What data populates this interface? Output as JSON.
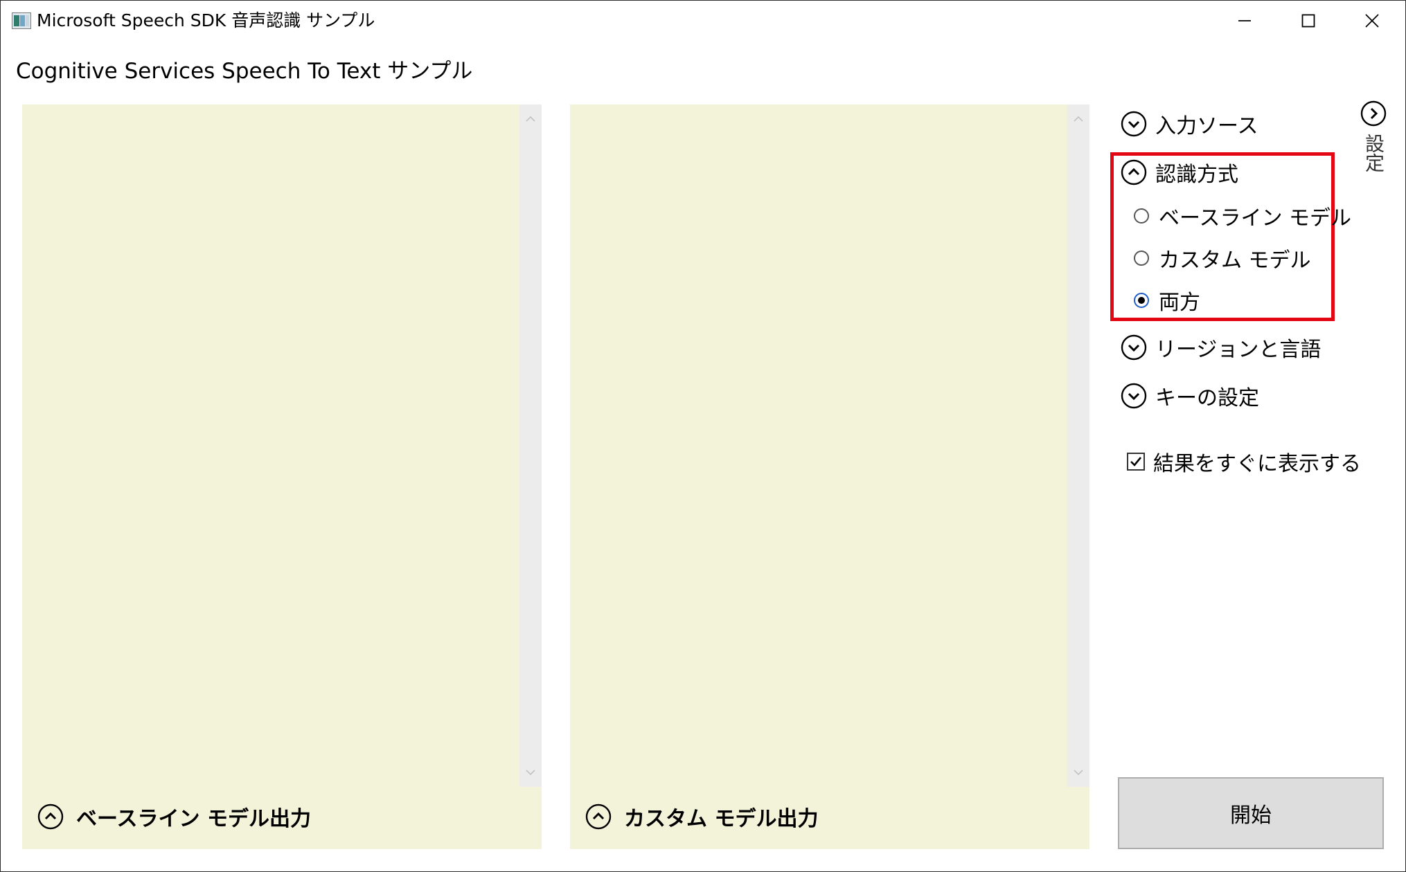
{
  "window": {
    "title": "Microsoft Speech SDK 音声認識 サンプル",
    "caption_buttons": [
      "minimize-icon",
      "maximize-icon",
      "close-icon"
    ]
  },
  "header": {
    "title": "Cognitive Services Speech To Text サンプル"
  },
  "panels": {
    "baseline": {
      "footer_label": "ベースライン モデル出力",
      "toggle_icon": "chevron-up-circle-icon"
    },
    "custom": {
      "footer_label": "カスタム モデル出力",
      "toggle_icon": "chevron-up-circle-icon"
    }
  },
  "settings": {
    "tab_label": "設定",
    "tab_icon": "chevron-right-circle-icon",
    "sections": {
      "input_source": {
        "label": "入力ソース",
        "expanded": false
      },
      "recognition_mode": {
        "label": "認識方式",
        "expanded": true,
        "options": [
          {
            "label": "ベースライン モデル",
            "checked": false
          },
          {
            "label": "カスタム モデル",
            "checked": false
          },
          {
            "label": "両方",
            "checked": true
          }
        ]
      },
      "region_language": {
        "label": "リージョンと言語",
        "expanded": false
      },
      "key_settings": {
        "label": "キーの設定",
        "expanded": false
      }
    },
    "show_results_immediately": {
      "label": "結果をすぐに表示する",
      "checked": true
    },
    "start_button_label": "開始"
  },
  "colors": {
    "panel_background": "#f3f3da",
    "highlight_border": "#e30613",
    "button_background": "#dddddd",
    "scrollbar_track": "#ececec"
  }
}
